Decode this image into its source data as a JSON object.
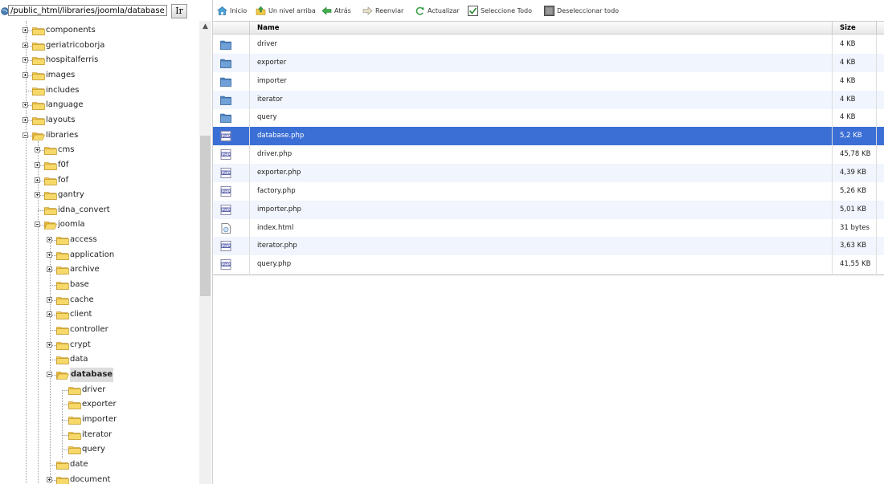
{
  "path_bar": {
    "value": "/public_html/libraries/joomla/database",
    "go_label": "Ir"
  },
  "toolbar": [
    {
      "label": "Inicio",
      "icon": "home-icon"
    },
    {
      "label": "Un nivel arriba",
      "icon": "up-level-icon"
    },
    {
      "label": "Atrás",
      "icon": "back-arrow-icon"
    },
    {
      "label": "Reenviar",
      "icon": "forward-arrow-icon"
    },
    {
      "label": "Actualizar",
      "icon": "refresh-icon"
    },
    {
      "label": "Seleccione Todo",
      "icon": "checkbox-checked-icon"
    },
    {
      "label": "Deseleccionar todo",
      "icon": "checkbox-unchecked-icon"
    }
  ],
  "tree": [
    {
      "label": "components",
      "level": 0,
      "expandable": true
    },
    {
      "label": "geriatricoborja",
      "level": 0,
      "expandable": true
    },
    {
      "label": "hospitalferris",
      "level": 0,
      "expandable": true
    },
    {
      "label": "images",
      "level": 0,
      "expandable": true
    },
    {
      "label": "includes",
      "level": 0,
      "expandable": false
    },
    {
      "label": "language",
      "level": 0,
      "expandable": true
    },
    {
      "label": "layouts",
      "level": 0,
      "expandable": true
    },
    {
      "label": "libraries",
      "level": 0,
      "expandable": true,
      "expanded": true
    },
    {
      "label": "cms",
      "level": 1,
      "expandable": true
    },
    {
      "label": "f0f",
      "level": 1,
      "expandable": true
    },
    {
      "label": "fof",
      "level": 1,
      "expandable": true
    },
    {
      "label": "gantry",
      "level": 1,
      "expandable": true
    },
    {
      "label": "idna_convert",
      "level": 1,
      "expandable": false
    },
    {
      "label": "joomla",
      "level": 1,
      "expandable": true,
      "expanded": true
    },
    {
      "label": "access",
      "level": 2,
      "expandable": true
    },
    {
      "label": "application",
      "level": 2,
      "expandable": true
    },
    {
      "label": "archive",
      "level": 2,
      "expandable": true
    },
    {
      "label": "base",
      "level": 2,
      "expandable": false
    },
    {
      "label": "cache",
      "level": 2,
      "expandable": true
    },
    {
      "label": "client",
      "level": 2,
      "expandable": true
    },
    {
      "label": "controller",
      "level": 2,
      "expandable": false
    },
    {
      "label": "crypt",
      "level": 2,
      "expandable": true
    },
    {
      "label": "data",
      "level": 2,
      "expandable": false
    },
    {
      "label": "database",
      "level": 2,
      "expandable": true,
      "expanded": true,
      "selected": true
    },
    {
      "label": "driver",
      "level": 3,
      "expandable": false
    },
    {
      "label": "exporter",
      "level": 3,
      "expandable": false
    },
    {
      "label": "importer",
      "level": 3,
      "expandable": false
    },
    {
      "label": "iterator",
      "level": 3,
      "expandable": false
    },
    {
      "label": "query",
      "level": 3,
      "expandable": false
    },
    {
      "label": "date",
      "level": 2,
      "expandable": false
    },
    {
      "label": "document",
      "level": 2,
      "expandable": true
    }
  ],
  "table": {
    "columns": {
      "name": "Name",
      "size": "Size"
    },
    "rows": [
      {
        "name": "driver",
        "size": "4 KB",
        "type": "folder"
      },
      {
        "name": "exporter",
        "size": "4 KB",
        "type": "folder"
      },
      {
        "name": "importer",
        "size": "4 KB",
        "type": "folder"
      },
      {
        "name": "iterator",
        "size": "4 KB",
        "type": "folder"
      },
      {
        "name": "query",
        "size": "4 KB",
        "type": "folder"
      },
      {
        "name": "database.php",
        "size": "5,2 KB",
        "type": "php",
        "selected": true
      },
      {
        "name": "driver.php",
        "size": "45,78 KB",
        "type": "php"
      },
      {
        "name": "exporter.php",
        "size": "4,39 KB",
        "type": "php"
      },
      {
        "name": "factory.php",
        "size": "5,26 KB",
        "type": "php"
      },
      {
        "name": "importer.php",
        "size": "5,01 KB",
        "type": "php"
      },
      {
        "name": "index.html",
        "size": "31 bytes",
        "type": "html"
      },
      {
        "name": "iterator.php",
        "size": "3,63 KB",
        "type": "php"
      },
      {
        "name": "query.php",
        "size": "41,55 KB",
        "type": "php"
      }
    ]
  },
  "colors": {
    "selection": "#3b6fd6",
    "row_alt": "#f1f5fd",
    "folder": "#f0c84a",
    "tree_selected": "#dddddd"
  }
}
